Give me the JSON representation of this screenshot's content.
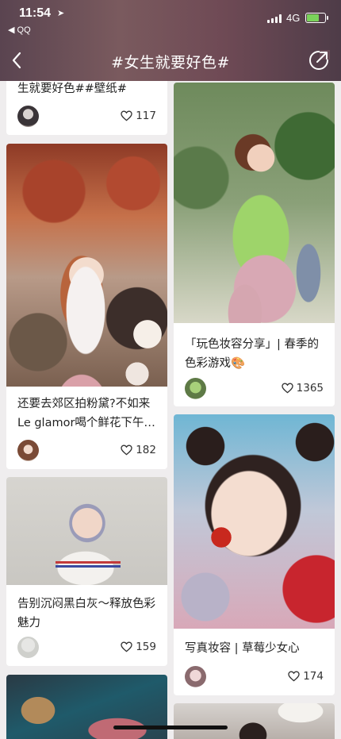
{
  "status": {
    "time": "11:54",
    "back_app": "◀ QQ",
    "network": "4G",
    "battery_level": 0.7
  },
  "nav": {
    "title": "#女生就要好色#"
  },
  "colors": {
    "header": "#6a4c56",
    "battery": "#7ad35a",
    "page_bg": "#efedee"
  },
  "feed": {
    "left": [
      {
        "title": "生就要好色##壁纸#",
        "likes": "117"
      },
      {
        "title": "还要去郊区拍粉黛?不如来Le glamor喝个鲜花下午…",
        "likes": "182"
      },
      {
        "title": "告别沉闷黑白灰～释放色彩魅力",
        "likes": "159"
      },
      {
        "title": ""
      }
    ],
    "right": [
      {
        "title": "「玩色妆容分享」| 春季的色彩游戏🎨",
        "likes": "1365"
      },
      {
        "title": "写真妆容 | 草莓少女心",
        "likes": "174"
      },
      {
        "title": ""
      }
    ]
  }
}
